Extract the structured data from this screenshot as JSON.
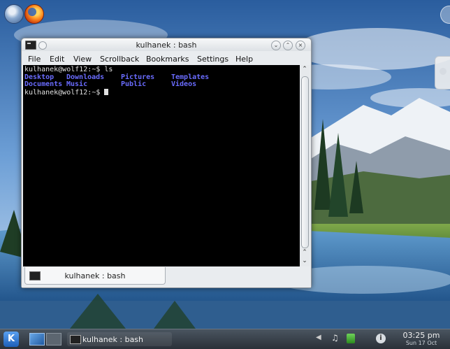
{
  "desktop": {
    "top_icons": [
      {
        "name": "web-browser-icon"
      },
      {
        "name": "firefox-icon"
      }
    ]
  },
  "window": {
    "title": "kulhanek : bash",
    "menu": [
      "File",
      "Edit",
      "View",
      "Scrollback",
      "Bookmarks",
      "Settings",
      "Help"
    ],
    "terminal": {
      "prompt_1": "kulhanek@wolf12:~$ ls",
      "row_1": [
        "Desktop",
        "Downloads",
        "Pictures",
        "Templates"
      ],
      "row_2": [
        "Documents",
        "Music",
        "Public",
        "Videos"
      ],
      "prompt_2": "kulhanek@wolf12:~$ "
    },
    "tab_label": "kulhanek : bash"
  },
  "panel": {
    "kmenu_label": "K",
    "task_label": "kulhanek : bash",
    "clock_time": "03:25 pm",
    "clock_date": "Sun 17 Oct",
    "info_label": "i"
  }
}
